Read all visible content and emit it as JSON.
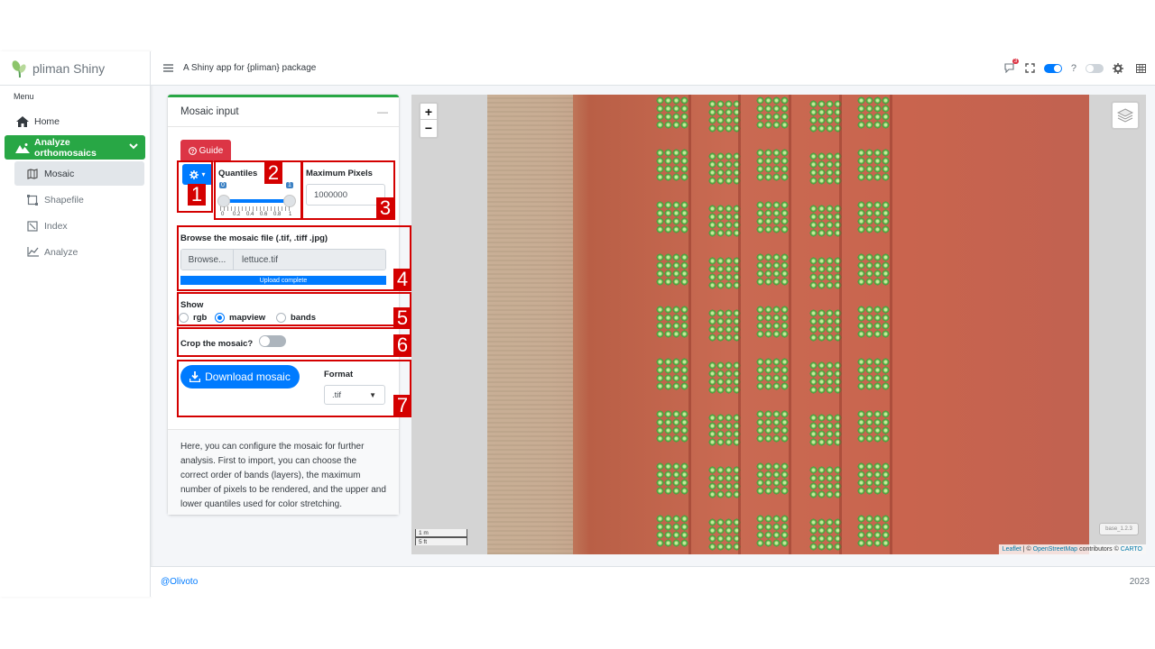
{
  "brand": {
    "name": "pliman Shiny"
  },
  "header": {
    "title": "A Shiny app for {pliman} package",
    "notification_count": "3",
    "help": "?"
  },
  "sidebar": {
    "menu_header": "Menu",
    "items": [
      {
        "label": "Home",
        "icon": "home-icon"
      },
      {
        "label": "Analyze orthomosaics",
        "icon": "mountain-icon"
      },
      {
        "label": "Mosaic",
        "icon": "map-icon"
      },
      {
        "label": "Shapefile",
        "icon": "shapefile-icon"
      },
      {
        "label": "Index",
        "icon": "index-icon"
      },
      {
        "label": "Analyze",
        "icon": "line-chart-icon"
      }
    ]
  },
  "card": {
    "title": "Mosaic input",
    "collapse": "—",
    "guide_label": "Guide",
    "quantiles": {
      "label": "Quantiles",
      "low": "0",
      "high": "1",
      "ticks": [
        "0",
        "0.2",
        "0.4",
        "0.6",
        "0.8",
        "1"
      ]
    },
    "max_pixels": {
      "label": "Maximum Pixels",
      "value": "1000000"
    },
    "browse": {
      "label": "Browse the mosaic file (.tif, .tiff .jpg)",
      "button": "Browse...",
      "file": "lettuce.tif",
      "progress_text": "Upload complete",
      "progress": 1.0
    },
    "show": {
      "label": "Show",
      "options": [
        "rgb",
        "mapview",
        "bands"
      ],
      "selected": "mapview"
    },
    "crop": {
      "label": "Crop the mosaic?",
      "on": false
    },
    "download": {
      "label": "Download mosaic"
    },
    "format": {
      "label": "Format",
      "value": ".tif"
    },
    "footer_text": "Here, you can configure the mosaic for further analysis. First to import, you can choose the correct order of bands (layers), the maximum number of pixels to be rendered, and the upper and lower quantiles used for color stretching."
  },
  "annotations": [
    "1",
    "2",
    "3",
    "4",
    "5",
    "6",
    "7"
  ],
  "map": {
    "zoom_in": "+",
    "zoom_out": "−",
    "scale_m": "1 m",
    "scale_ft": "5 ft",
    "base_badge": "base_1.2.3",
    "attribution": {
      "leaflet": "Leaflet",
      "sep": "| ©",
      "osm": "OpenStreetMap",
      "contrib": "contributors ©",
      "carto": "CARTO"
    }
  },
  "footer": {
    "author": "@Olivoto",
    "year": "2023"
  },
  "colors": {
    "accent_green": "#28a745",
    "primary_blue": "#007bff",
    "danger_red": "#dc3545",
    "annotation_red": "#d40000"
  }
}
